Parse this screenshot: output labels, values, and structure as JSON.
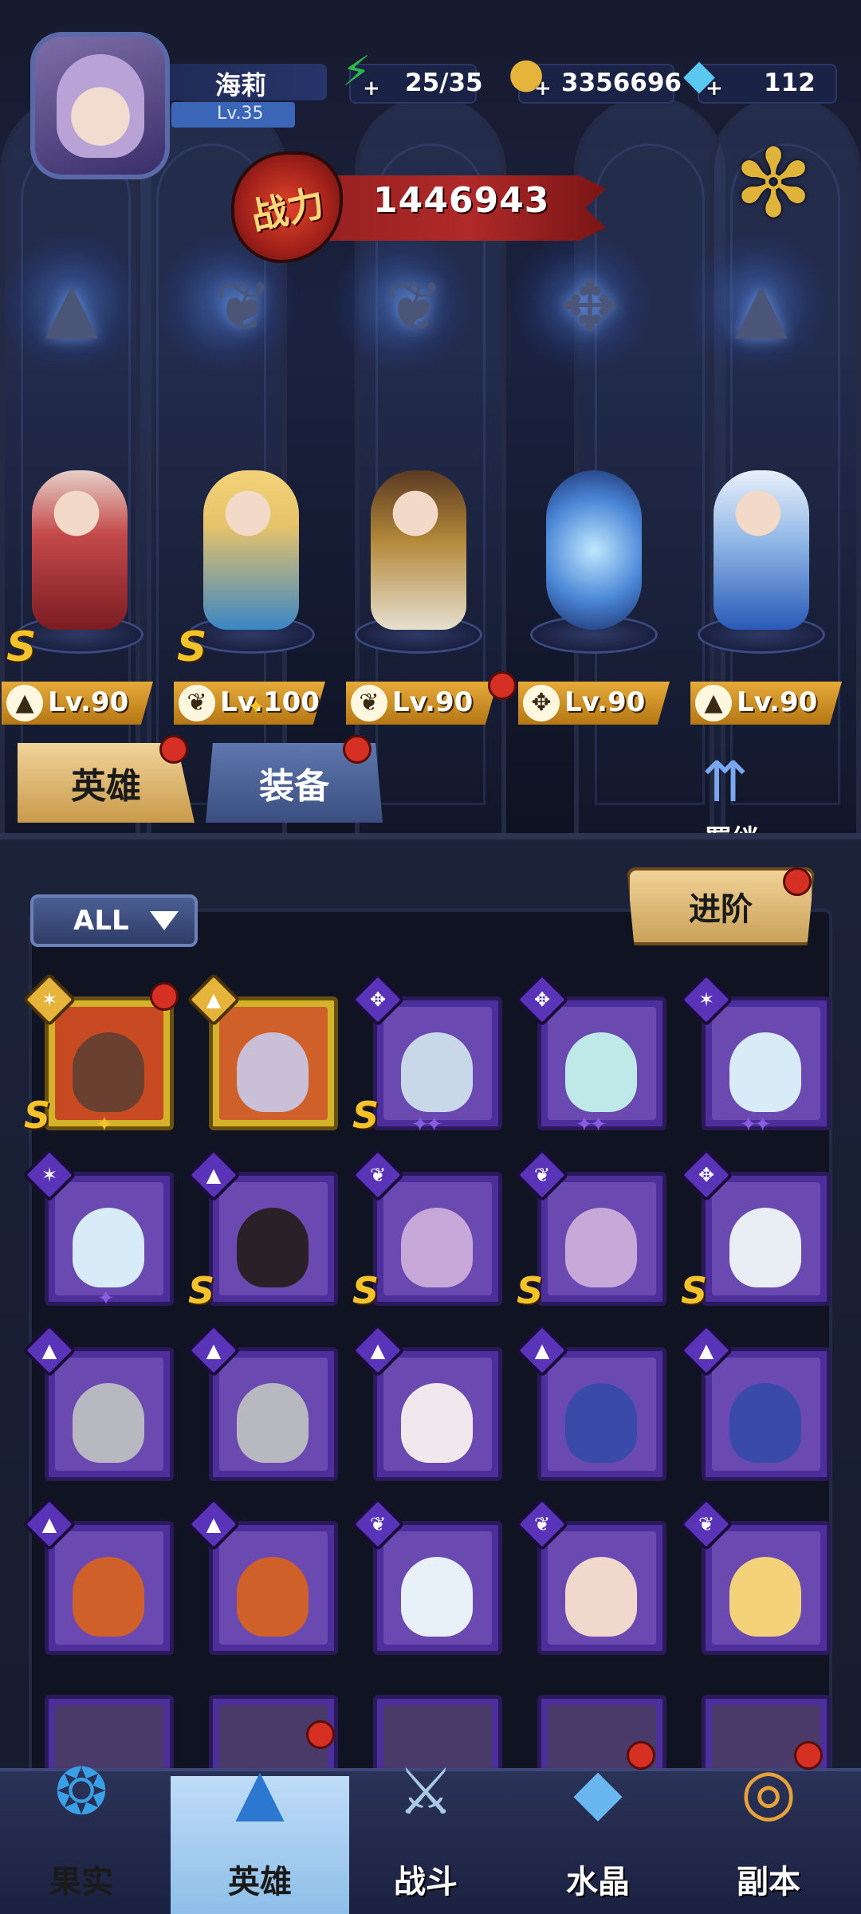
{
  "player": {
    "name": "海莉",
    "level": "Lv.35"
  },
  "resources": {
    "energy": {
      "value": "25/35",
      "icon": "lightning-icon",
      "color": "#2fb84a"
    },
    "gold": {
      "value": "3356696",
      "icon": "coin-icon",
      "color": "#e6b43a"
    },
    "diamond": {
      "value": "112",
      "icon": "diamond-icon",
      "color": "#5ac8f0"
    }
  },
  "power": {
    "label": "战力",
    "value": "1446943"
  },
  "team": [
    {
      "level": "Lv.90",
      "grade": "S",
      "class_icon": "hat-icon",
      "color": "#c44a4a"
    },
    {
      "level": "Lv.100",
      "grade": "S",
      "class_icon": "wing-icon",
      "color": "#e6c36a"
    },
    {
      "level": "Lv.90",
      "grade": "",
      "class_icon": "wing-icon",
      "color": "#b58a3a"
    },
    {
      "level": "Lv.90",
      "grade": "",
      "class_icon": "wrench-icon",
      "color": "#4a86d6"
    },
    {
      "level": "Lv.90",
      "grade": "",
      "class_icon": "hat-icon",
      "color": "#8fb6e6"
    }
  ],
  "tabs": {
    "heroes": "英雄",
    "equipment": "装备",
    "bond": "羁绊"
  },
  "filter": {
    "label": "ALL"
  },
  "advance": {
    "label": "进阶"
  },
  "nav": {
    "fruit": "果实",
    "heroes": "英雄",
    "battle": "战斗",
    "crystal": "水晶",
    "dungeon": "副本"
  },
  "colors": {
    "accent_gold": "#e6aa3a",
    "card_purple": "#4c2f9a",
    "notify_red": "#d63024"
  }
}
